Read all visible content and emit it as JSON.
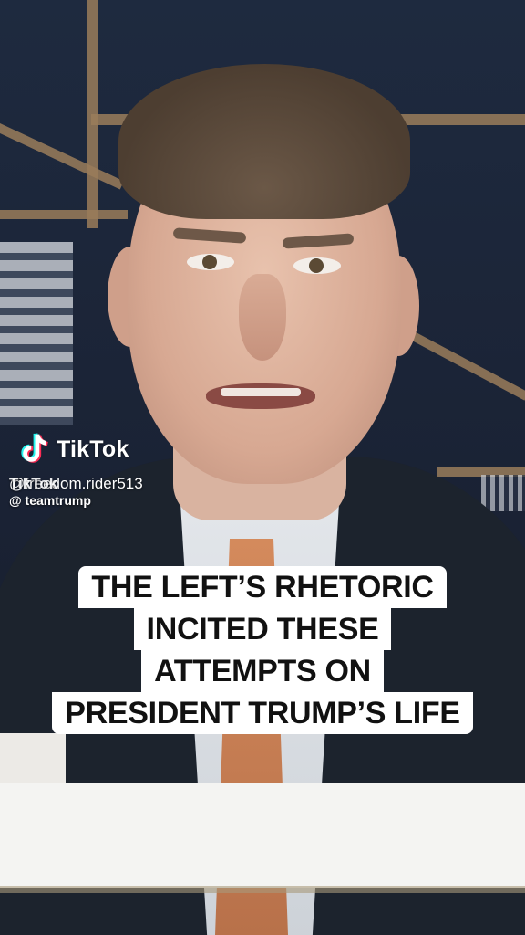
{
  "watermark": {
    "brand": "TikTok",
    "username_overlap": "TikTok",
    "username": "@freedom.rider513",
    "handle": "@ teamtrump"
  },
  "caption": {
    "lines": [
      "THE LEFT’S RHETORIC",
      "INCITED THESE",
      "ATTEMPTS ON",
      "PRESIDENT TRUMP’S LIFE"
    ]
  },
  "colors": {
    "caption_bg": "#ffffff",
    "caption_text": "#111111",
    "tiktok_cyan": "#25F4EE",
    "tiktok_red": "#FE2C55"
  },
  "icons": [
    "tiktok-logo-icon"
  ]
}
